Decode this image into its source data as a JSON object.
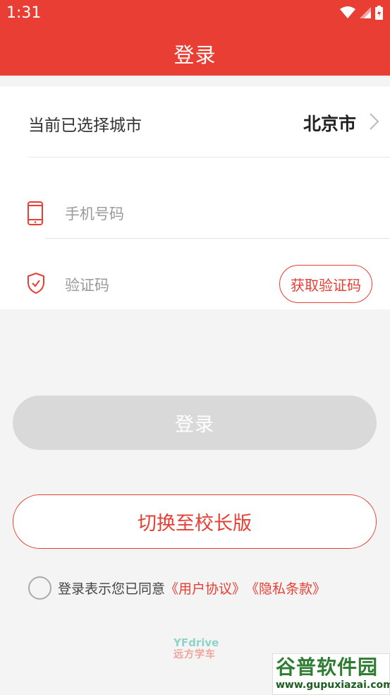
{
  "status_bar": {
    "time": "1:31"
  },
  "header": {
    "title": "登录"
  },
  "city": {
    "label": "当前已选择城市",
    "value": "北京市"
  },
  "phone": {
    "placeholder": "手机号码"
  },
  "code": {
    "placeholder": "验证码",
    "button_label": "获取验证码"
  },
  "login_button": "登录",
  "switch_button": "切换至校长版",
  "agreement": {
    "text": "登录表示您已同意",
    "user_agreement": "《用户协议》",
    "privacy": "《隐私条款》"
  },
  "brand": {
    "en": "YFdrive",
    "cn": "远方学车"
  },
  "watermark": {
    "main": "谷普软件园",
    "url": "www.gupuxiazai.com"
  },
  "colors": {
    "accent": "#e83e33",
    "disabled": "#d9d9d9",
    "background": "#f4f4f4"
  }
}
